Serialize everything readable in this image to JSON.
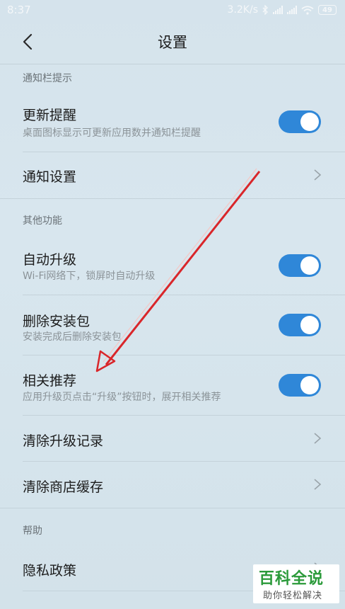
{
  "status_bar": {
    "time": "8:37",
    "network_speed": "3.2K/s",
    "battery": "49",
    "icons": [
      "bluetooth-icon",
      "signal-icon",
      "signal-icon",
      "wifi-icon",
      "battery-icon"
    ]
  },
  "header": {
    "back_icon": "chevron-left-icon",
    "title": "设置"
  },
  "sections": [
    {
      "header": "通知栏提示",
      "items": [
        {
          "title": "更新提醒",
          "subtitle": "桌面图标显示可更新应用数并通知栏提醒",
          "control": "toggle",
          "on": true
        },
        {
          "title": "通知设置",
          "control": "chevron"
        }
      ]
    },
    {
      "header": "其他功能",
      "items": [
        {
          "title": "自动升级",
          "subtitle": "Wi-Fi网络下，锁屏时自动升级",
          "control": "toggle",
          "on": true
        },
        {
          "title": "删除安装包",
          "subtitle": "安装完成后删除安装包",
          "control": "toggle",
          "on": true
        },
        {
          "title": "相关推荐",
          "subtitle": "应用升级页点击“升级”按钮时，展开相关推荐",
          "control": "toggle",
          "on": true
        },
        {
          "title": "清除升级记录",
          "control": "chevron"
        },
        {
          "title": "清除商店缓存",
          "control": "chevron"
        }
      ]
    },
    {
      "header": "帮助",
      "items": [
        {
          "title": "隐私政策",
          "control": "chevron"
        }
      ]
    }
  ],
  "colors": {
    "toggle_on": "#2f87d8",
    "annotation_arrow": "#d9262a",
    "watermark_text": "#2b9a3a"
  },
  "watermark": {
    "line1": "百科全说",
    "line2": "助你轻松解决"
  }
}
